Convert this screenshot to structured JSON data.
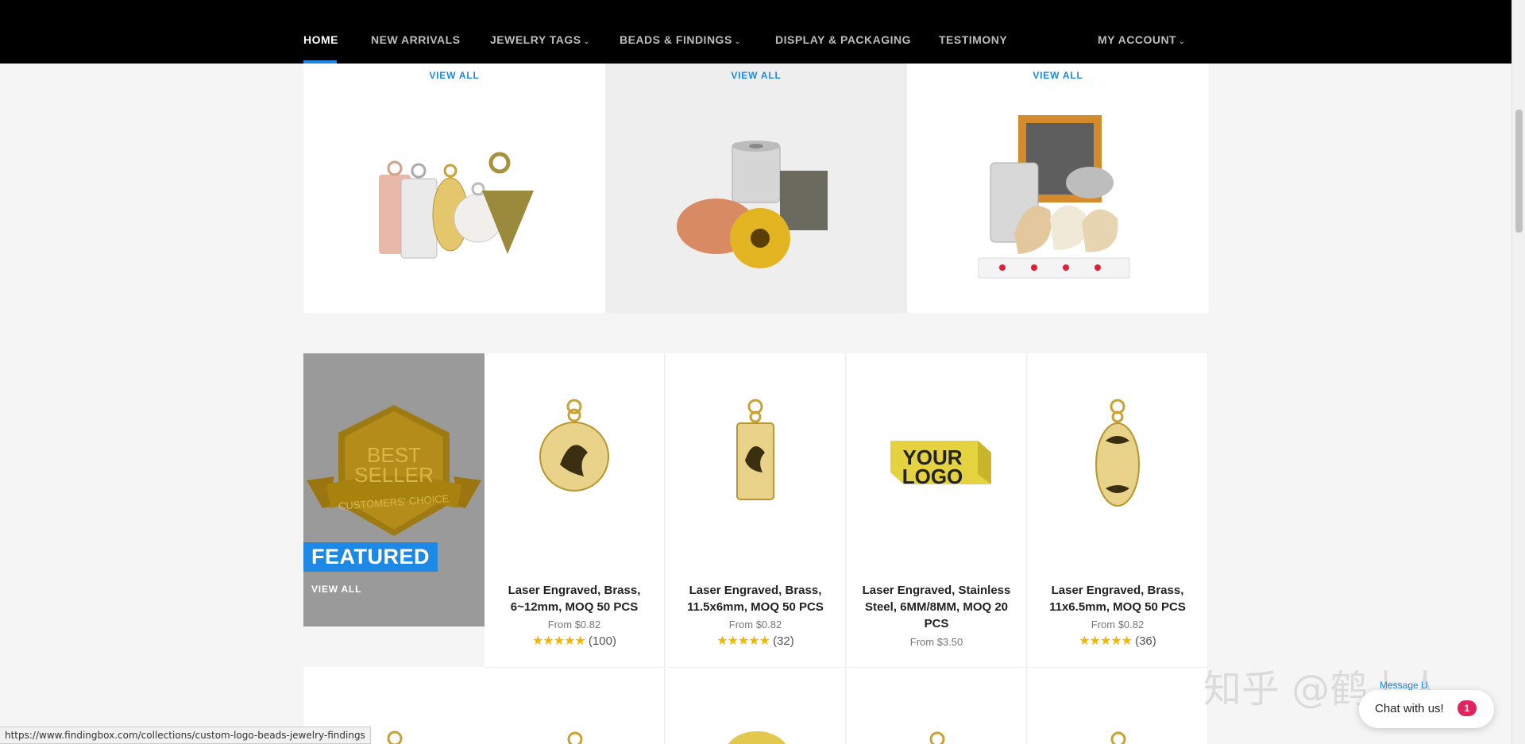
{
  "nav": {
    "items": [
      {
        "label": "HOME",
        "caret": ""
      },
      {
        "label": "NEW ARRIVALS",
        "caret": ""
      },
      {
        "label": "JEWELRY TAGS",
        "caret": "⌄"
      },
      {
        "label": "BEADS & FINDINGS",
        "caret": "⌄"
      },
      {
        "label": "DISPLAY & PACKAGING",
        "caret": ""
      },
      {
        "label": "TESTIMONY",
        "caret": ""
      }
    ],
    "account": {
      "label": "MY ACCOUNT",
      "caret": "⌄"
    }
  },
  "categories": [
    {
      "view_all": "VIEW ALL",
      "image": "jewelry-tags"
    },
    {
      "view_all": "VIEW ALL",
      "image": "beads-findings"
    },
    {
      "view_all": "VIEW ALL",
      "image": "display-packaging"
    }
  ],
  "featured": {
    "badge_line1": "BEST",
    "badge_line2": "SELLER",
    "ribbon": "CUSTOMERS' CHOICE",
    "title": "FEATURED",
    "view_all": "VIEW ALL"
  },
  "products": [
    {
      "title": "Laser Engraved, Brass, 6~12mm, MOQ 50 PCS",
      "price": "From $0.82",
      "stars": "★★★★★",
      "reviews": "(100)",
      "image": "round-tag"
    },
    {
      "title": "Laser Engraved, Brass, 11.5x6mm, MOQ 50 PCS",
      "price": "From $0.82",
      "stars": "★★★★★",
      "reviews": "(32)",
      "image": "rect-tag"
    },
    {
      "title": "Laser Engraved, Stainless Steel, 6MM/8MM, MOQ 20 PCS",
      "price": "From $3.50",
      "stars": "",
      "reviews": "",
      "image": "logo-bead"
    },
    {
      "title": "Laser Engraved, Brass, 11x6.5mm, MOQ 50 PCS",
      "price": "From $0.82",
      "stars": "★★★★★",
      "reviews": "(36)",
      "image": "oval-tag"
    }
  ],
  "status_url": "https://www.findingbox.com/collections/custom-logo-beads-jewelry-findings",
  "watermark": "知乎 @鹤上人",
  "chat": {
    "label": "Chat with us!",
    "badge": "1",
    "message_label": "Message U"
  },
  "colors": {
    "accent": "#1e88e5",
    "nav_bg": "#000000",
    "star": "#f7b500",
    "gold": "#c9a233"
  }
}
